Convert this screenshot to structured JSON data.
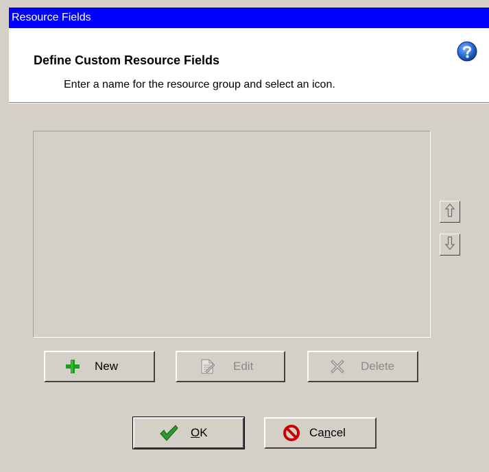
{
  "window": {
    "title": "Resource Fields"
  },
  "header": {
    "title": "Define Custom Resource Fields",
    "subtitle": "Enter a name for the resource group and select an icon."
  },
  "list": {
    "items": []
  },
  "buttons": {
    "new": "New",
    "edit": "Edit",
    "delete": "Delete",
    "ok_mnemonic": "O",
    "ok_rest": "K",
    "cancel_pre": "Ca",
    "cancel_mnemonic": "n",
    "cancel_post": "cel"
  },
  "icons": {
    "help": "help-question-icon",
    "move_up": "arrow-up-icon",
    "move_down": "arrow-down-icon",
    "new": "plus-icon",
    "edit": "edit-document-icon",
    "delete": "delete-x-icon",
    "ok": "checkmark-icon",
    "cancel": "no-symbol-icon"
  },
  "colors": {
    "titlebar": "#0000ff",
    "dialog_background": "#d4d0c8",
    "header_background": "#ffffff",
    "plus_green": "#1aa01a",
    "check_green": "#2a9a2a",
    "cancel_red": "#cc0000",
    "help_blue": "#2a6fd6"
  }
}
